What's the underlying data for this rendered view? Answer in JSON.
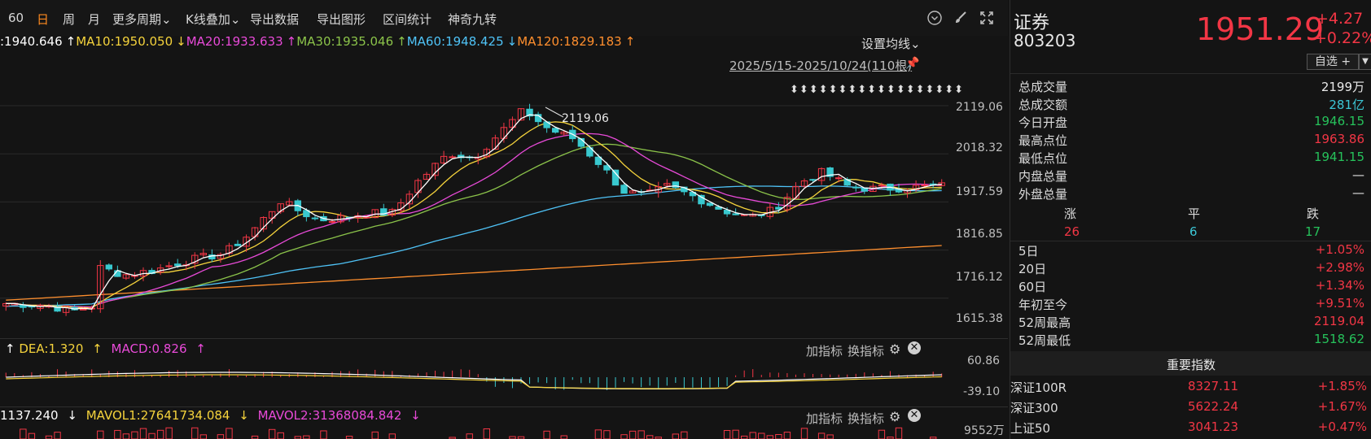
{
  "toolbar": {
    "periods": [
      "60",
      "日",
      "周",
      "月",
      "更多周期",
      "K线叠加",
      "导出数据",
      "导出图形",
      "区间统计",
      "神奇九转"
    ],
    "active_period": "日",
    "icons": [
      "circle-down-icon",
      "brush-icon",
      "fullscreen-icon"
    ]
  },
  "ma": {
    "ma5": ":1940.646",
    "ma10": "MA10:1950.050",
    "ma20": "MA20:1933.633",
    "ma30": "MA30:1935.046",
    "ma60": "MA60:1948.425",
    "ma120": "MA120:1829.183",
    "settings": "设置均线",
    "range": "2025/5/15-2025/10/24(110根)",
    "peak_label": "2119.06",
    "colors": {
      "ma5": "#ffffff",
      "ma10": "#f5d33c",
      "ma20": "#e84ad8",
      "ma30": "#8bc34a",
      "ma60": "#4fc3f7",
      "ma120": "#ff8f2e"
    }
  },
  "price_axis": [
    "2119.06",
    "2018.32",
    "1917.59",
    "1816.85",
    "1716.12",
    "1615.38"
  ],
  "macd": {
    "dea": "DEA:1.320",
    "macd": "MACD:0.826",
    "axis": [
      "60.86",
      "-39.10"
    ],
    "add_indicator": "加指标",
    "change_indicator": "换指标"
  },
  "volume": {
    "vol": "1137.240",
    "mavol1": "MAVOL1:27641734.084",
    "mavol2": "MAVOL2:31368084.842",
    "axis": "9552万",
    "add_indicator": "加指标",
    "change_indicator": "换指标"
  },
  "panel": {
    "name": "证券",
    "code": "803203",
    "price": "1951.29",
    "change": "+4.27",
    "change_pct": "+0.22%",
    "watch_button": "自选 +",
    "stats": [
      {
        "label": "总成交量",
        "value": "2199万",
        "color": "white"
      },
      {
        "label": "总成交额",
        "value": "281亿",
        "color": "cyan"
      },
      {
        "label": "今日开盘",
        "value": "1946.15",
        "color": "green"
      },
      {
        "label": "最高点位",
        "value": "1963.86",
        "color": "red"
      },
      {
        "label": "最低点位",
        "value": "1941.15",
        "color": "green"
      },
      {
        "label": "内盘总量",
        "value": "—",
        "color": "white"
      },
      {
        "label": "外盘总量",
        "value": "—",
        "color": "white"
      }
    ],
    "breadth": {
      "up_label": "涨",
      "flat_label": "平",
      "down_label": "跌",
      "up": "26",
      "flat": "6",
      "down": "17"
    },
    "returns": [
      {
        "label": "5日",
        "value": "+1.05%",
        "color": "red"
      },
      {
        "label": "20日",
        "value": "+2.98%",
        "color": "red"
      },
      {
        "label": "60日",
        "value": "+1.34%",
        "color": "red"
      },
      {
        "label": "年初至今",
        "value": "+9.51%",
        "color": "red"
      },
      {
        "label": "52周最高",
        "value": "2119.04",
        "color": "red"
      },
      {
        "label": "52周最低",
        "value": "1518.62",
        "color": "green"
      }
    ],
    "indices_title": "重要指数",
    "indices": [
      {
        "name": "深证100R",
        "value": "8327.11",
        "pct": "+1.85%"
      },
      {
        "name": "深证300",
        "value": "5622.24",
        "pct": "+1.67%"
      },
      {
        "name": "上证50",
        "value": "3041.23",
        "pct": "+0.47%"
      }
    ]
  }
}
